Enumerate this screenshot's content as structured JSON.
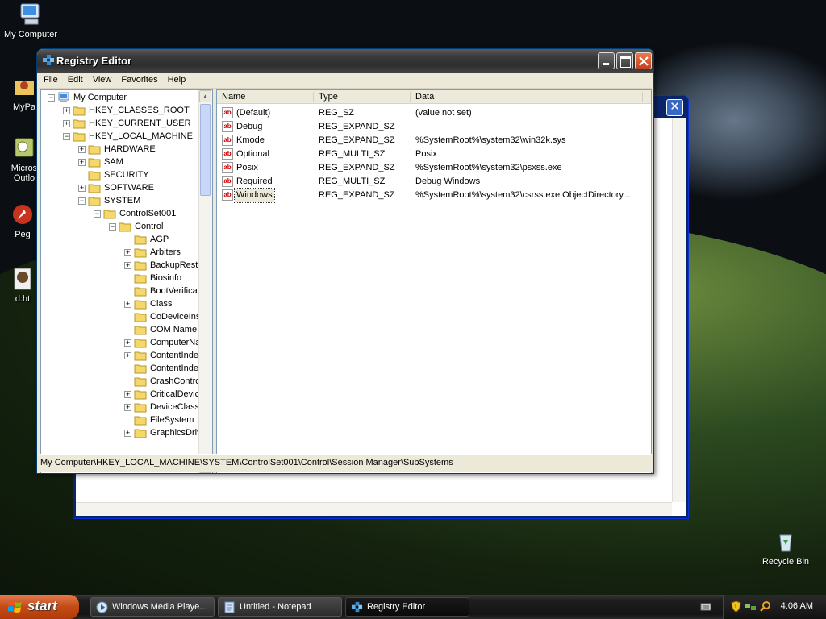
{
  "desktop": {
    "icons": [
      {
        "label": "My Computer"
      },
      {
        "label": "MyPa"
      },
      {
        "label": "Micros\nOutlo"
      },
      {
        "label": "Peg"
      },
      {
        "label": "d.ht"
      },
      {
        "label": "Recycle Bin"
      }
    ]
  },
  "window": {
    "title": "Registry Editor",
    "menu": [
      "File",
      "Edit",
      "View",
      "Favorites",
      "Help"
    ],
    "tree": [
      {
        "label": "My Computer",
        "indent": 0,
        "toggle": "-"
      },
      {
        "label": "HKEY_CLASSES_ROOT",
        "indent": 1,
        "toggle": "+"
      },
      {
        "label": "HKEY_CURRENT_USER",
        "indent": 1,
        "toggle": "+"
      },
      {
        "label": "HKEY_LOCAL_MACHINE",
        "indent": 1,
        "toggle": "-"
      },
      {
        "label": "HARDWARE",
        "indent": 2,
        "toggle": "+"
      },
      {
        "label": "SAM",
        "indent": 2,
        "toggle": "+"
      },
      {
        "label": "SECURITY",
        "indent": 2,
        "toggle": ""
      },
      {
        "label": "SOFTWARE",
        "indent": 2,
        "toggle": "+"
      },
      {
        "label": "SYSTEM",
        "indent": 2,
        "toggle": "-"
      },
      {
        "label": "ControlSet001",
        "indent": 3,
        "toggle": "-"
      },
      {
        "label": "Control",
        "indent": 4,
        "toggle": "-"
      },
      {
        "label": "AGP",
        "indent": 5,
        "toggle": ""
      },
      {
        "label": "Arbiters",
        "indent": 5,
        "toggle": "+"
      },
      {
        "label": "BackupResto",
        "indent": 5,
        "toggle": "+"
      },
      {
        "label": "Biosinfo",
        "indent": 5,
        "toggle": ""
      },
      {
        "label": "BootVerifica",
        "indent": 5,
        "toggle": ""
      },
      {
        "label": "Class",
        "indent": 5,
        "toggle": "+"
      },
      {
        "label": "CoDeviceIns",
        "indent": 5,
        "toggle": ""
      },
      {
        "label": "COM Name A",
        "indent": 5,
        "toggle": ""
      },
      {
        "label": "ComputerNa",
        "indent": 5,
        "toggle": "+"
      },
      {
        "label": "ContentInde",
        "indent": 5,
        "toggle": "+"
      },
      {
        "label": "ContentInde",
        "indent": 5,
        "toggle": ""
      },
      {
        "label": "CrashContro",
        "indent": 5,
        "toggle": ""
      },
      {
        "label": "CriticalDevic",
        "indent": 5,
        "toggle": "+"
      },
      {
        "label": "DeviceClass",
        "indent": 5,
        "toggle": "+"
      },
      {
        "label": "FileSystem",
        "indent": 5,
        "toggle": ""
      },
      {
        "label": "GraphicsDriv",
        "indent": 5,
        "toggle": "+"
      }
    ],
    "columns": [
      "Name",
      "Type",
      "Data"
    ],
    "values": [
      {
        "name": "(Default)",
        "type": "REG_SZ",
        "data": "(value not set)"
      },
      {
        "name": "Debug",
        "type": "REG_EXPAND_SZ",
        "data": ""
      },
      {
        "name": "Kmode",
        "type": "REG_EXPAND_SZ",
        "data": "%SystemRoot%\\system32\\win32k.sys"
      },
      {
        "name": "Optional",
        "type": "REG_MULTI_SZ",
        "data": "Posix"
      },
      {
        "name": "Posix",
        "type": "REG_EXPAND_SZ",
        "data": "%SystemRoot%\\system32\\psxss.exe"
      },
      {
        "name": "Required",
        "type": "REG_MULTI_SZ",
        "data": "Debug Windows"
      },
      {
        "name": "Windows",
        "type": "REG_EXPAND_SZ",
        "data": "%SystemRoot%\\system32\\csrss.exe ObjectDirectory..."
      }
    ],
    "selected_value": "Windows",
    "status": "My Computer\\HKEY_LOCAL_MACHINE\\SYSTEM\\ControlSet001\\Control\\Session Manager\\SubSystems"
  },
  "taskbar": {
    "start_label": "start",
    "tasks": [
      {
        "label": "Windows Media Playe...",
        "icon": "media-player-icon",
        "active": false
      },
      {
        "label": "Untitled - Notepad",
        "icon": "notepad-icon",
        "active": false
      },
      {
        "label": "Registry Editor",
        "icon": "regedit-icon",
        "active": true
      }
    ],
    "clock": "4:06 AM"
  },
  "colors": {
    "titlebar": "#3a3a3a",
    "start_button": "#c24b16",
    "window_face": "#ece9d8",
    "folder": "#f5d86a"
  }
}
